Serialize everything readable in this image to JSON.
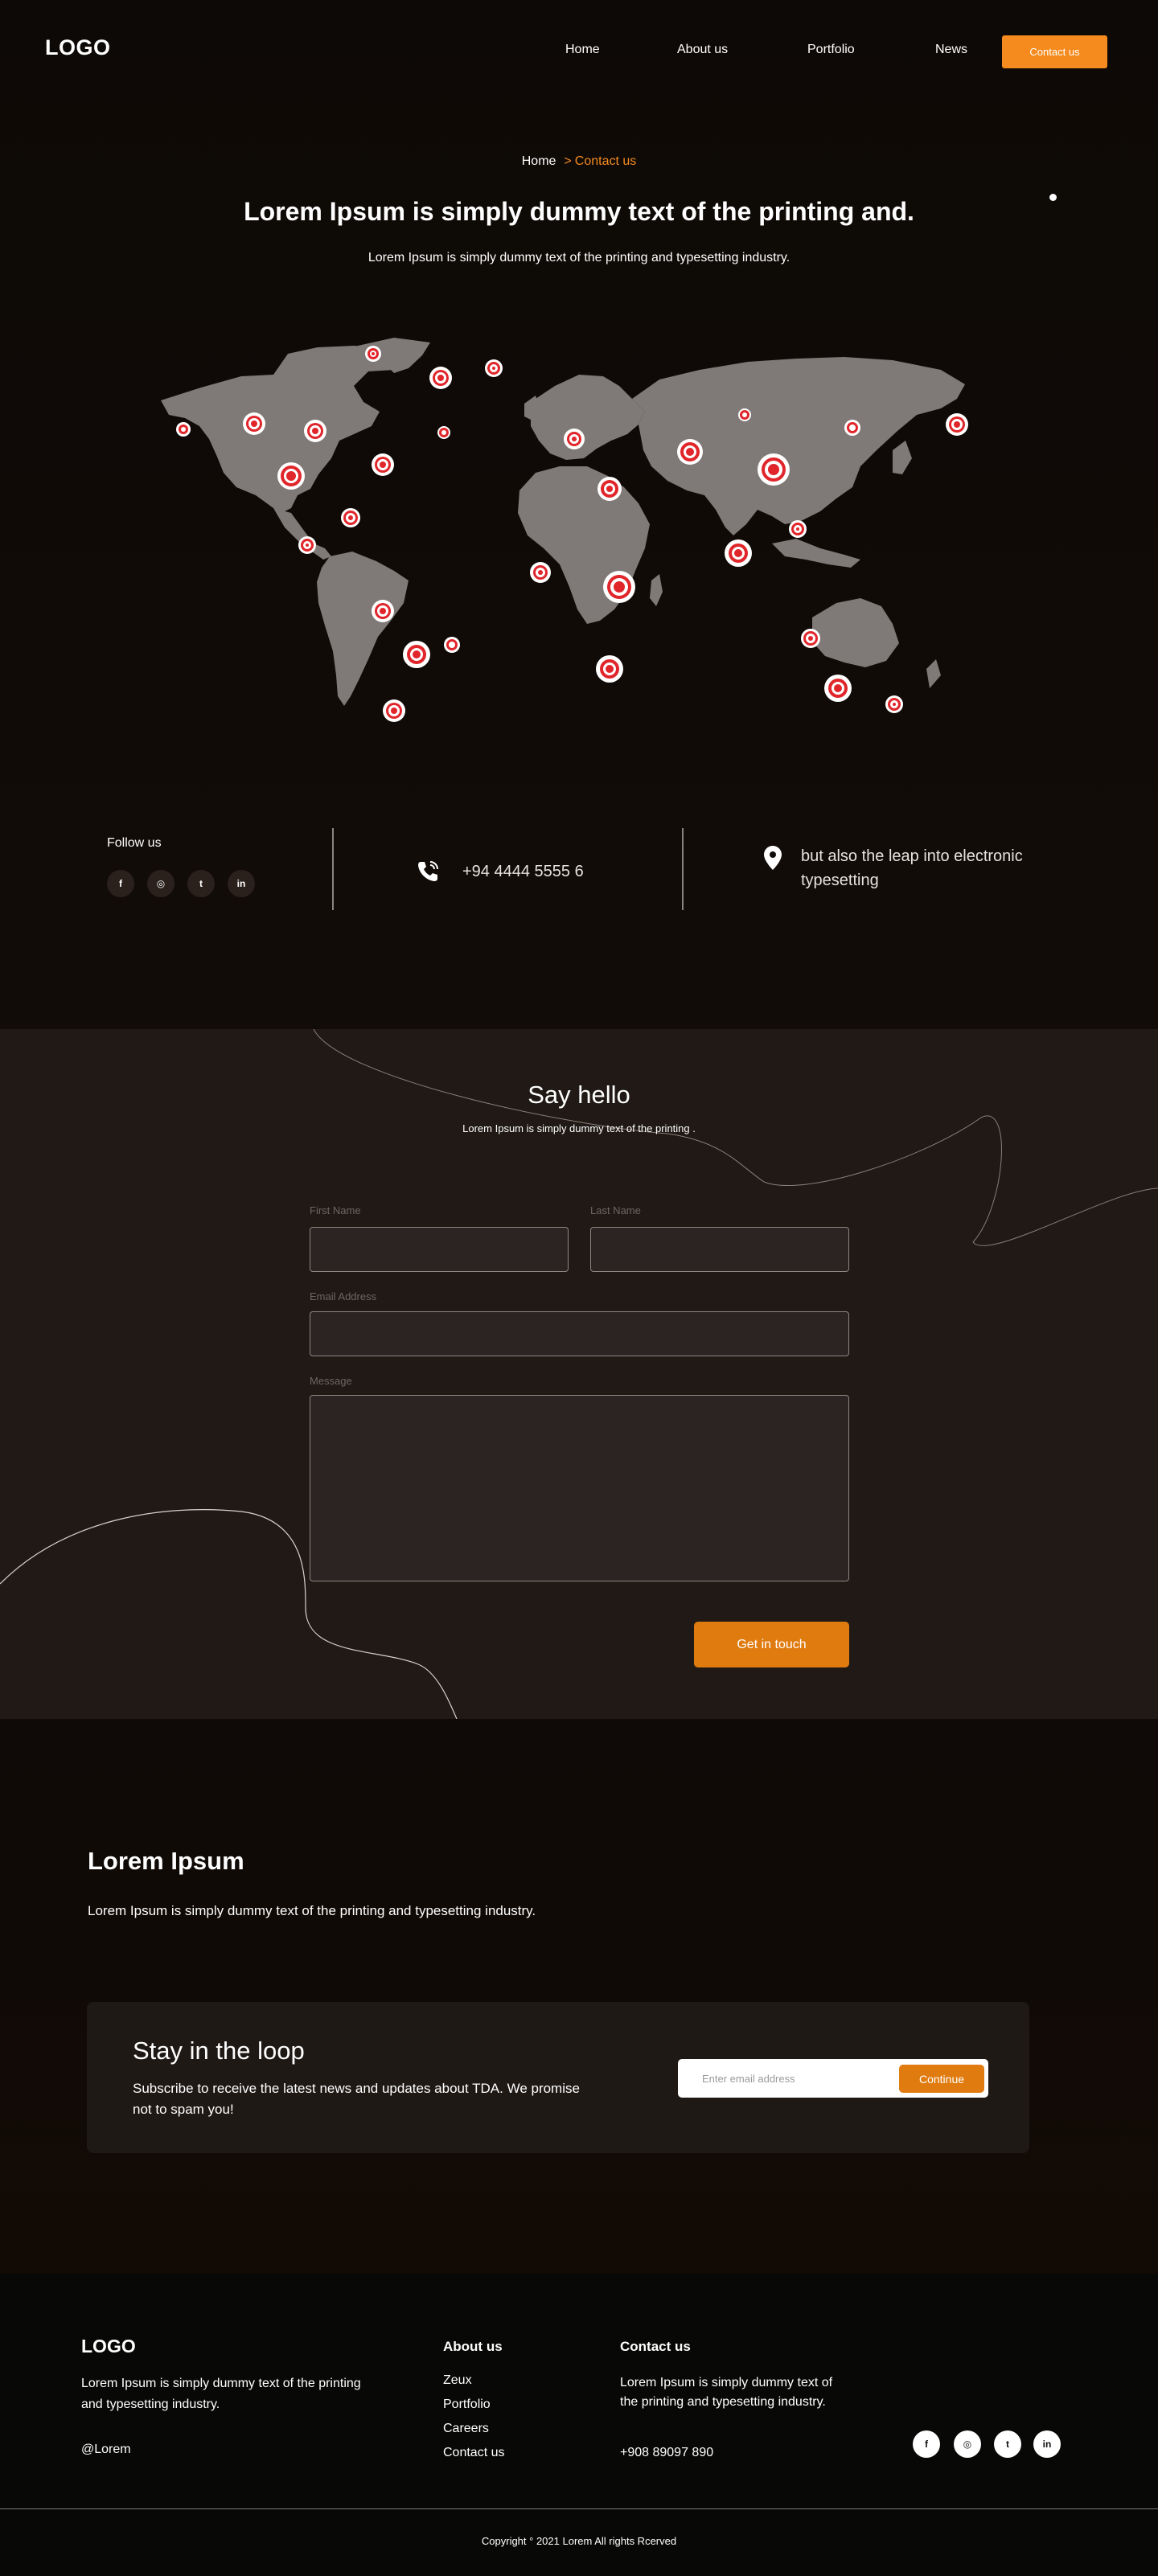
{
  "header": {
    "logo": "LOGO",
    "nav": [
      {
        "label": "Home"
      },
      {
        "label": "About us"
      },
      {
        "label": "Portfolio"
      },
      {
        "label": "News"
      }
    ],
    "cta_label": "Contact us"
  },
  "hero": {
    "breadcrumb": {
      "home": "Home",
      "separator": ">",
      "current": "Contact us"
    },
    "title": "Lorem Ipsum is simply dummy text of the printing and.",
    "subtitle": "Lorem Ipsum is simply dummy text of the printing and typesetting industry."
  },
  "info": {
    "follow_label": "Follow us",
    "socials": [
      {
        "icon": "facebook-icon",
        "glyph": "f"
      },
      {
        "icon": "instagram-icon",
        "glyph": "◎"
      },
      {
        "icon": "twitter-icon",
        "glyph": "t"
      },
      {
        "icon": "linkedin-icon",
        "glyph": "in"
      }
    ],
    "phone": "+94 4444 5555 6",
    "address": "but also the leap into electronic typesetting"
  },
  "contact_form": {
    "title": "Say hello",
    "subtitle": "Lorem Ipsum is simply dummy text of the printing .",
    "first_name_label": "First Name",
    "last_name_label": "Last Name",
    "email_label": "Email Address",
    "message_label": "Message",
    "submit_label": "Get in touch"
  },
  "about": {
    "title": "Lorem Ipsum",
    "text": "Lorem Ipsum is simply dummy text of the printing and typesetting industry."
  },
  "newsletter": {
    "title": "Stay in the loop",
    "text": "Subscribe to receive the latest news and updates about TDA. We promise not to spam you!",
    "placeholder": "Enter email address",
    "button_label": "Continue"
  },
  "footer": {
    "logo": "LOGO",
    "description": "Lorem Ipsum is simply dummy text of the printing and typesetting industry.",
    "handle": "@Lorem",
    "about_heading": "About us",
    "about_links": [
      "Zeux",
      "Portfolio",
      "Careers",
      "Contact us"
    ],
    "contact_heading": "Contact us",
    "contact_text": "Lorem Ipsum is simply dummy text of the printing and typesetting industry.",
    "contact_phone": "+908 89097 890",
    "socials": [
      {
        "icon": "facebook-icon",
        "glyph": "f"
      },
      {
        "icon": "instagram-icon",
        "glyph": "◎"
      },
      {
        "icon": "twitter-icon",
        "glyph": "t"
      },
      {
        "icon": "linkedin-icon",
        "glyph": "in"
      }
    ],
    "copyright": "Copyright ° 2021 Lorem All rights Rcerved"
  },
  "colors": {
    "accent": "#f58b1f",
    "accent_dark": "#e07b10",
    "map_land": "#7f7a77",
    "marker_red": "#e0262b"
  }
}
